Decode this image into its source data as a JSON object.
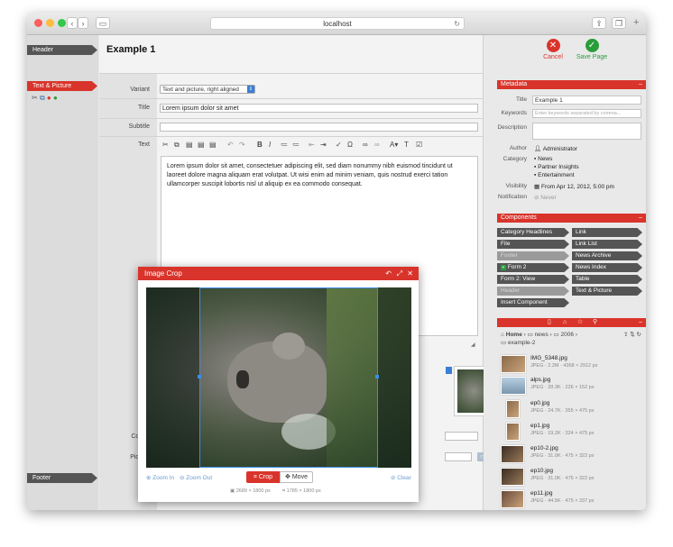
{
  "browser": {
    "url": "localhost"
  },
  "rail": {
    "header": "Header",
    "text_picture": "Text & Picture",
    "footer": "Footer"
  },
  "editor": {
    "title": "Example 1",
    "variant_label": "Variant",
    "variant_value": "Text and picture, right aligned",
    "title_label": "Title",
    "title_value": "Lorem ipsum dolor sit amet",
    "subtitle_label": "Subtitle",
    "text_label": "Text",
    "body_text": "Lorem ipsum dolor sit amet, consectetuer adipiscing elit, sed diam nonummy nibh euismod tincidunt ut laoreet dolore magna aliquam erat volutpat. Ut wisi enim ad minim veniam, quis nostrud exerci tation ullamcorper suscipit lobortis nisl ut aliquip ex ea commodo consequat.",
    "pic_label": "Pic",
    "pic_comment_label_1": "Pic",
    "pic_comment_label_2": "Comm",
    "picture_label": "Picture"
  },
  "actions": {
    "cancel": "Cancel",
    "save": "Save Page"
  },
  "metadata": {
    "heading": "Metadata",
    "title_label": "Title",
    "title_value": "Example 1",
    "keywords_label": "Keywords",
    "keywords_placeholder": "Enter keywords separated by comma...",
    "description_label": "Description",
    "author_label": "Author",
    "author_value": "Administrator",
    "category_label": "Category",
    "categories": [
      "News",
      "Partner Insights",
      "Entertainment"
    ],
    "visibility_label": "Visibility",
    "visibility_value": "From Apr 12, 2012, 5:00 pm",
    "notification_label": "Notification",
    "notification_value": "Never"
  },
  "components": {
    "heading": "Components",
    "left": [
      "Category Headlines",
      "File",
      "Footer",
      "Form 2",
      "Form 2: View",
      "Header",
      "Insert Component"
    ],
    "right": [
      "Link",
      "Link List",
      "News Archive",
      "News Index",
      "Table",
      "Text & Picture"
    ]
  },
  "files": {
    "breadcrumb_home": "Home",
    "breadcrumb_news": "news",
    "breadcrumb_year": "2006",
    "breadcrumb_folder": "example-2",
    "items": [
      {
        "name": "IMG_5348.jpg",
        "meta": "JPEG · 2.2M · 4368 × 2912 px"
      },
      {
        "name": "alps.jpg",
        "meta": "JPEG · 28.3K · 226 × 152 px"
      },
      {
        "name": "ep0.jpg",
        "meta": "JPEG · 24.7K · 355 × 475 px"
      },
      {
        "name": "ep1.jpg",
        "meta": "JPEG · 19.2K · 324 × 475 px"
      },
      {
        "name": "ep10-2.jpg",
        "meta": "JPEG · 31.0K · 475 × 322 px"
      },
      {
        "name": "ep10.jpg",
        "meta": "JPEG · 31.0K · 475 × 322 px"
      },
      {
        "name": "ep11.jpg",
        "meta": "JPEG · 44.5K · 475 × 337 px"
      }
    ]
  },
  "crop": {
    "title": "Image Crop",
    "zoom_in": "Zoom In",
    "zoom_out": "Zoom Out",
    "crop_btn": "Crop",
    "move_btn": "Move",
    "clear": "Clear",
    "original_size": "2689 × 1800 px",
    "crop_size": "1785 × 1800 px"
  },
  "colors": {
    "accent": "#d9342b",
    "dark_tag": "#555555",
    "save_green": "#2a9d3a"
  }
}
